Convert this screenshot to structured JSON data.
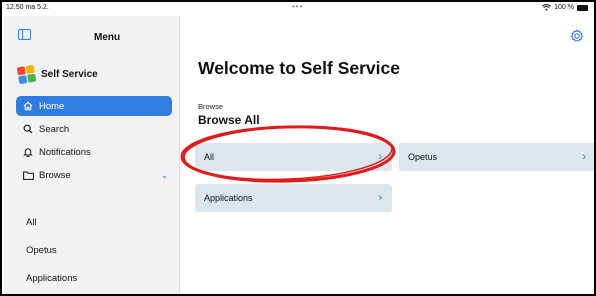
{
  "status_bar": {
    "time": "12.50 ma 5.2.",
    "dots": "•••",
    "wifi_icon": "wifi-icon",
    "battery": "100 %"
  },
  "sidebar": {
    "toggle_icon": "sidebar-toggle-icon",
    "title": "Menu",
    "brand": {
      "name": "Self Service",
      "logo_icon": "self-service-logo"
    },
    "items": [
      {
        "label": "Home",
        "icon": "house-icon",
        "active": true
      },
      {
        "label": "Search",
        "icon": "magnifier-icon",
        "active": false
      },
      {
        "label": "Notifications",
        "icon": "bell-icon",
        "active": false
      },
      {
        "label": "Browse",
        "icon": "folder-icon",
        "active": false,
        "expanded": true
      }
    ],
    "browse_children": [
      "All",
      "Opetus",
      "Applications"
    ]
  },
  "main": {
    "settings_icon": "gear-icon",
    "title": "Welcome to Self Service",
    "section_label": "Browse",
    "section_title": "Browse All",
    "cards": [
      {
        "label": "All",
        "highlighted": true
      },
      {
        "label": "Opetus"
      },
      {
        "label": "Applications"
      }
    ]
  },
  "colors": {
    "accent": "#2f7de1",
    "card_bg": "#dce6ee",
    "sidebar_bg": "#f2f2f5",
    "annotation": "#e01b1b"
  }
}
